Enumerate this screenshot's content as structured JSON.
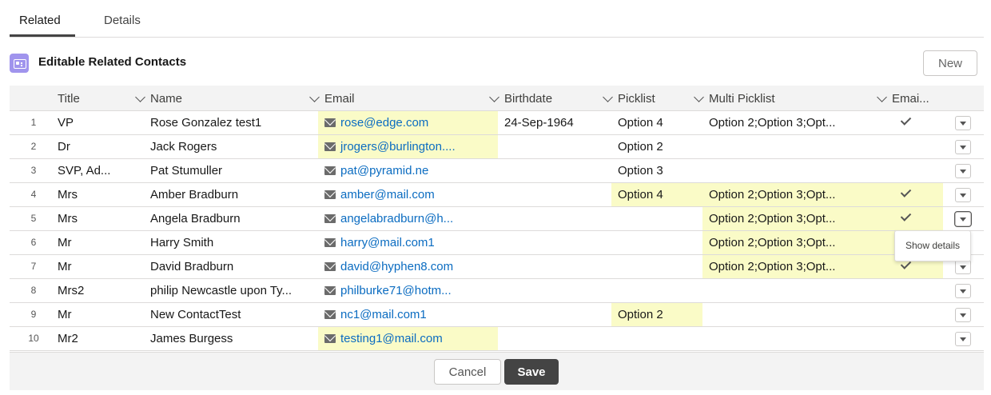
{
  "tabs": [
    {
      "label": "Related"
    },
    {
      "label": "Details"
    }
  ],
  "card": {
    "title": "Editable Related Contacts",
    "new_label": "New"
  },
  "columns": [
    {
      "label": "Title"
    },
    {
      "label": "Name"
    },
    {
      "label": "Email"
    },
    {
      "label": "Birthdate"
    },
    {
      "label": "Picklist"
    },
    {
      "label": "Multi Picklist"
    },
    {
      "label": "Emai..."
    }
  ],
  "rows": [
    {
      "num": "1",
      "title": "VP",
      "name": "Rose Gonzalez test1",
      "email": "rose@edge.com",
      "birthdate": "24-Sep-1964",
      "picklist": "Option 4",
      "multi": "Option 2;Option 3;Opt...",
      "email_opt": true
    },
    {
      "num": "2",
      "title": "Dr",
      "name": "Jack Rogers",
      "email": "jrogers@burlington....",
      "birthdate": "",
      "picklist": "Option 2",
      "multi": "",
      "email_opt": false
    },
    {
      "num": "3",
      "title": "SVP, Ad...",
      "name": "Pat Stumuller",
      "email": "pat@pyramid.ne",
      "birthdate": "",
      "picklist": "Option 3",
      "multi": "",
      "email_opt": false
    },
    {
      "num": "4",
      "title": "Mrs",
      "name": "Amber Bradburn",
      "email": "amber@mail.com",
      "birthdate": "",
      "picklist": "Option 4",
      "multi": "Option 2;Option 3;Opt...",
      "email_opt": true
    },
    {
      "num": "5",
      "title": "Mrs",
      "name": "Angela Bradburn",
      "email": "angelabradburn@h...",
      "birthdate": "",
      "picklist": "",
      "multi": "Option 2;Option 3;Opt...",
      "email_opt": true
    },
    {
      "num": "6",
      "title": "Mr",
      "name": "Harry Smith",
      "email": "harry@mail.com1",
      "birthdate": "",
      "picklist": "",
      "multi": "Option 2;Option 3;Opt...",
      "email_opt": true
    },
    {
      "num": "7",
      "title": "Mr",
      "name": "David Bradburn",
      "email": "david@hyphen8.com",
      "birthdate": "",
      "picklist": "",
      "multi": "Option 2;Option 3;Opt...",
      "email_opt": true
    },
    {
      "num": "8",
      "title": "Mrs2",
      "name": "philip Newcastle upon Ty...",
      "email": "philburke71@hotm...",
      "birthdate": "",
      "picklist": "",
      "multi": "",
      "email_opt": false
    },
    {
      "num": "9",
      "title": "Mr",
      "name": "New ContactTest",
      "email": "nc1@mail.com1",
      "birthdate": "",
      "picklist": "Option 2",
      "multi": "",
      "email_opt": false
    },
    {
      "num": "10",
      "title": "Mr2",
      "name": "James Burgess",
      "email": "testing1@mail.com",
      "birthdate": "",
      "picklist": "",
      "multi": "",
      "email_opt": false
    }
  ],
  "highlights": {
    "email": [
      1,
      2,
      10
    ],
    "picklist": [
      4,
      9
    ],
    "multi": [
      4,
      5,
      6,
      7
    ],
    "email_opt": [
      4,
      5,
      6,
      7
    ]
  },
  "tooltip": {
    "label": "Show details"
  },
  "footer": {
    "cancel_label": "Cancel",
    "save_label": "Save"
  },
  "colors": {
    "highlight": "#fafbc7",
    "link": "#0b6cc1",
    "save_bg": "#444444",
    "card_icon": "#a094ed"
  }
}
